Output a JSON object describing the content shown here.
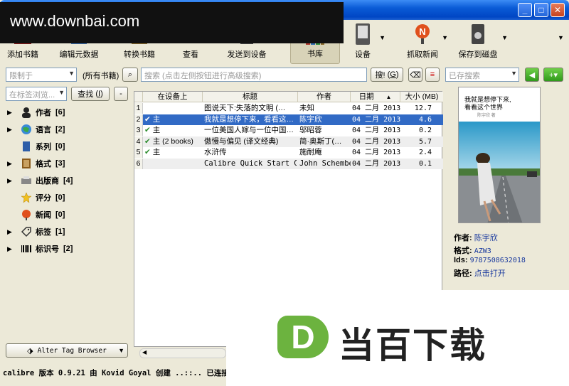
{
  "watermark_top": "www.downbai.com",
  "watermark_logo_letter": "D",
  "watermark_logo_text": "当百下载",
  "window_buttons": {
    "minimize": "_",
    "maximize": "□",
    "close": "✕"
  },
  "toolbar": {
    "add_book": "添加书籍",
    "edit_metadata": "编辑元数据",
    "convert": "转换书籍",
    "view": "查看",
    "send_to_device": "发送到设备",
    "library": "书库",
    "device": "设备",
    "fetch_news": "抓取新闻",
    "save_to_disk": "保存到磁盘"
  },
  "search": {
    "restrict_placeholder": "限制于",
    "all_books": "(所有书籍)",
    "search_placeholder": "搜索 (点击左侧按钮进行高级搜索)",
    "search_button": "搜!",
    "search_button_key": "G",
    "saved_search_placeholder": "已存搜索"
  },
  "tag_browser": {
    "filter_placeholder": "在标签浏览...",
    "find_button": "查找",
    "find_key": "I",
    "collapse_button": "-",
    "items": [
      {
        "label": "作者",
        "count": "[6]",
        "icon": "person-icon",
        "expandable": true
      },
      {
        "label": "语言",
        "count": "[2]",
        "icon": "globe-icon",
        "expandable": true
      },
      {
        "label": "系列",
        "count": "[0]",
        "icon": "series-icon",
        "expandable": false
      },
      {
        "label": "格式",
        "count": "[3]",
        "icon": "book-icon",
        "expandable": true
      },
      {
        "label": "出版商",
        "count": "[4]",
        "icon": "printer-icon",
        "expandable": true
      },
      {
        "label": "评分",
        "count": "[0]",
        "icon": "star-icon",
        "expandable": false
      },
      {
        "label": "新闻",
        "count": "[0]",
        "icon": "news-icon",
        "expandable": false
      },
      {
        "label": "标签",
        "count": "[1]",
        "icon": "tag-icon",
        "expandable": true
      },
      {
        "label": "标识号",
        "count": "[2]",
        "icon": "barcode-icon",
        "expandable": true
      }
    ],
    "alter_button": "Alter Tag Browser"
  },
  "table": {
    "columns": [
      "在设备上",
      "标题",
      "作者",
      "日期",
      "大小 (MB)"
    ],
    "sort_indicator": "▲",
    "rows": [
      {
        "num": "1",
        "on_device": "",
        "title": "图说天下:失落的文明 (…",
        "author": "未知",
        "date": "04 二月 2013",
        "size": "12.7"
      },
      {
        "num": "2",
        "on_device": "主",
        "title": "我就是想停下来，看看这…",
        "author": "陈宇欣",
        "date": "04 二月 2013",
        "size": "4.6"
      },
      {
        "num": "3",
        "on_device": "主",
        "title": "一位美国人嫁与一位中国…",
        "author": "邬昭蓉",
        "date": "04 二月 2013",
        "size": "0.2"
      },
      {
        "num": "4",
        "on_device": "主 (2 books)",
        "title": "傲慢与偏见 (译文经典)",
        "author": "简·奥斯丁(…",
        "date": "04 二月 2013",
        "size": "5.7"
      },
      {
        "num": "5",
        "on_device": "主",
        "title": "水浒传",
        "author": "施耐庵",
        "date": "04 二月 2013",
        "size": "2.4"
      },
      {
        "num": "6",
        "on_device": "",
        "title": "Calibre Quick Start Guide",
        "author": "John Schember",
        "date": "04 二月 2013",
        "size": "0.1"
      }
    ]
  },
  "cover": {
    "title_line1": "我就是想停下来,",
    "title_line2": "看看这个世界",
    "author_line": "陈宇欣 著"
  },
  "details": {
    "author_label": "作者:",
    "author_value": "陈宇欣",
    "format_label": "格式:",
    "format_value": "AZW3",
    "ids_label": "Ids:",
    "ids_value": "9787508632018",
    "path_label": "路径:",
    "path_value": "点击打开"
  },
  "status": "calibre 版本 0.9.21 由 Kovid Goyal 创建 ..::.. 已连接"
}
